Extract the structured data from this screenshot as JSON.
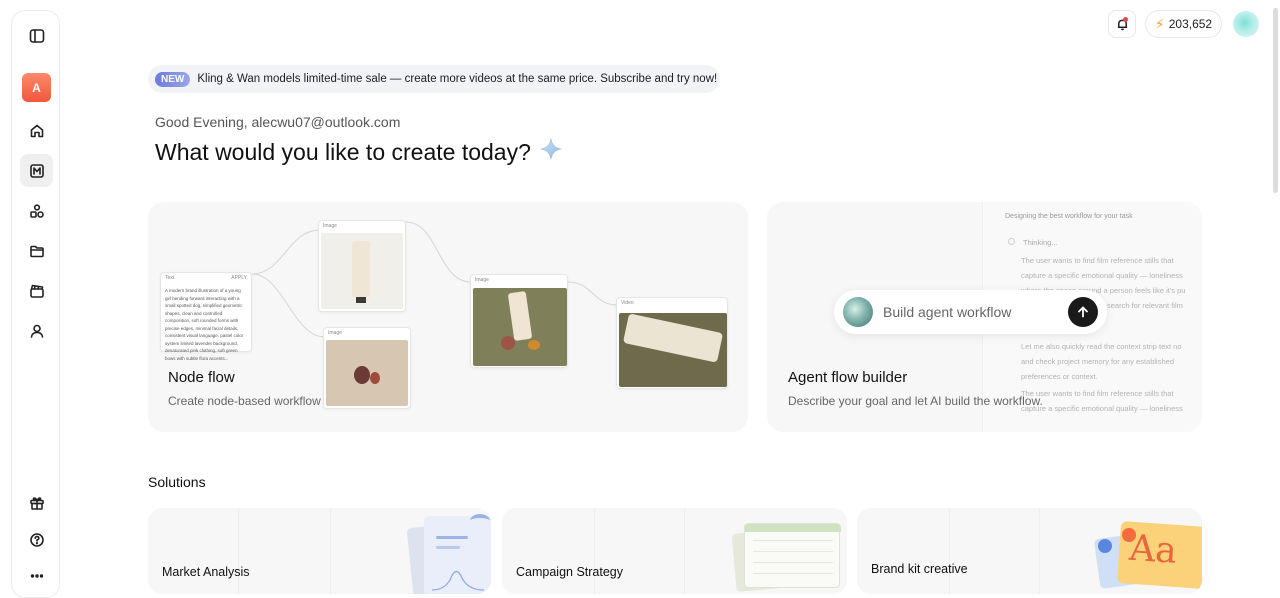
{
  "header": {
    "credits": "203,652"
  },
  "sidebar": {
    "workspace_initial": "A"
  },
  "announcement": {
    "badge": "NEW",
    "text": "Kling & Wan models limited-time sale — create more videos at the same price. Subscribe and try now!"
  },
  "greeting": "Good Evening, alecwu07@outlook.com",
  "headline": "What would you like to create today?",
  "node_flow": {
    "title": "Node flow",
    "description": "Create node-based workflow",
    "text_node_label": "Text",
    "text_node_apply": "APPLY",
    "text_node_body": "A modern brand illustration of a young girl bending forward interacting with a small spotted dog, simplified geometric shapes, clean and controlled composition, soft rounded forms with precise edges, minimal facial details, consistent visual language, pastel color system limited lavender background, desaturated pink clothing, soft green bows with subtle flora accents...",
    "image_node_label": "Image",
    "video_node_label": "Video"
  },
  "agent_flow": {
    "title": "Agent flow builder",
    "description": "Describe your goal and let AI build the workflow.",
    "panel_heading": "Designing the best workflow for your task",
    "thinking": "Thinking...",
    "lines": [
      "The user wants to find film reference stills that",
      "capture a specific emotional quality — loneliness",
      "where the space around a person feels like it's pu",
      "search for relevant film",
      "Let me also quickly read the context strip text no",
      "and check project memory for any established",
      "preferences or context.",
      "The user wants to find film reference stills that",
      "capture a specific emotional quality — loneliness"
    ],
    "input_placeholder": "Build agent workflow"
  },
  "solutions": {
    "title": "Solutions",
    "items": [
      {
        "label": "Market Analysis"
      },
      {
        "label": "Campaign Strategy"
      },
      {
        "label": "Brand kit creative",
        "art_text": "Aa"
      }
    ]
  },
  "colors": {
    "accent_gradient_start": "#6d7bd9",
    "workspace_avatar": "#f0573c",
    "notification_dot": "#f04848",
    "bolt": "#f5a623"
  }
}
